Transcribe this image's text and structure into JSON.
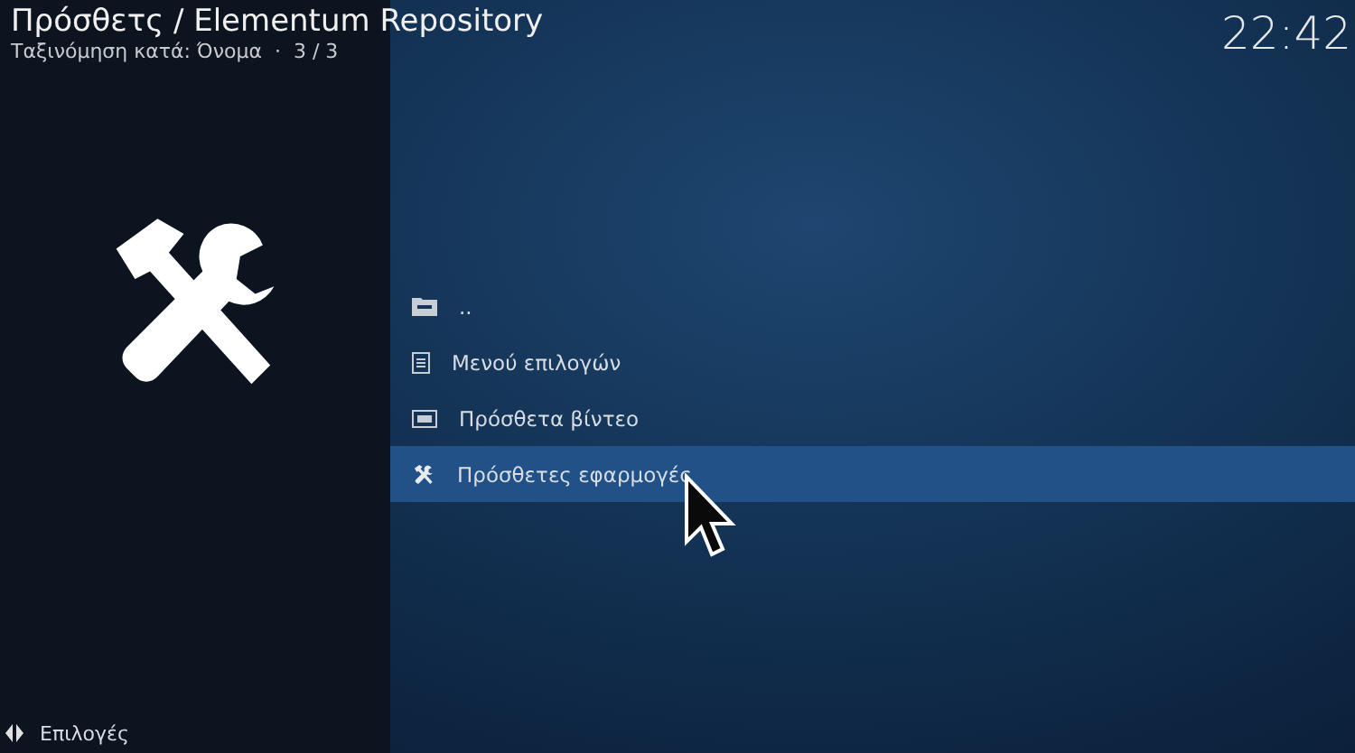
{
  "header": {
    "title": "Πρόσθετς / Elementum Repository",
    "subtitle": "Ταξινόμηση κατά: Όνομα  ·  3 / 3",
    "clock": "22:42"
  },
  "items": [
    {
      "kind": "parent",
      "label": "..",
      "selected": false
    },
    {
      "kind": "menu",
      "label": "Μενού επιλογών",
      "selected": false
    },
    {
      "kind": "video",
      "label": "Πρόσθετα βίντεο",
      "selected": false
    },
    {
      "kind": "tools",
      "label": "Πρόσθετες εφαρμογές",
      "selected": true
    }
  ],
  "footer": {
    "label": "Επιλογές"
  }
}
